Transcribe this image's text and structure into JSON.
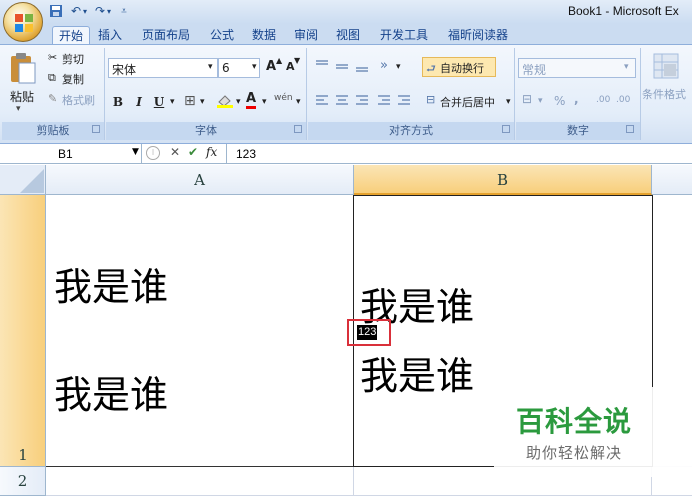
{
  "window": {
    "title": "Book1 - Microsoft Ex",
    "qat": [
      {
        "icon": "save-icon"
      },
      {
        "icon": "undo-icon"
      },
      {
        "icon": "redo-icon"
      },
      {
        "icon": "customize-qat-icon"
      }
    ]
  },
  "tabs": [
    "开始",
    "插入",
    "页面布局",
    "公式",
    "数据",
    "审阅",
    "视图",
    "开发工具",
    "福昕阅读器"
  ],
  "ribbon": {
    "clipboard": {
      "paste": "粘贴",
      "cut": "剪切",
      "copy": "复制",
      "format_painter": "格式刷",
      "group_label": "剪贴板"
    },
    "font": {
      "font_name": "宋体",
      "font_size": "6",
      "bold": "B",
      "italic": "I",
      "underline": "U",
      "grow": "A",
      "shrink": "A",
      "font_color_letter": "A",
      "phonetic": "wén",
      "group_label": "字体"
    },
    "alignment": {
      "wrap_text": "自动换行",
      "merge_center": "合并后居中",
      "group_label": "对齐方式"
    },
    "number": {
      "format": "常规",
      "percent": "%",
      "comma": ",",
      "inc_decimal": ".00",
      "dec_decimal": ".00",
      "group_label": "数字"
    },
    "styles": {
      "conditional": "条件格式"
    }
  },
  "formula_bar": {
    "name_box": "B1",
    "fx": "fx",
    "value": "123"
  },
  "grid": {
    "columns": [
      "A",
      "B"
    ],
    "rows": [
      "1",
      "2"
    ],
    "cells": {
      "A1_line1": "我是谁",
      "A1_line2": "我是谁",
      "B1_line1": "我是谁",
      "B1_edit": "123",
      "B1_line2": "我是谁"
    }
  },
  "watermark": {
    "title": "百科全说",
    "subtitle": "助你轻松解决"
  },
  "colors": {
    "selected_header": "#f8cf7c",
    "highlight_border": "#d9303a",
    "watermark_green": "#2b9a3e"
  }
}
